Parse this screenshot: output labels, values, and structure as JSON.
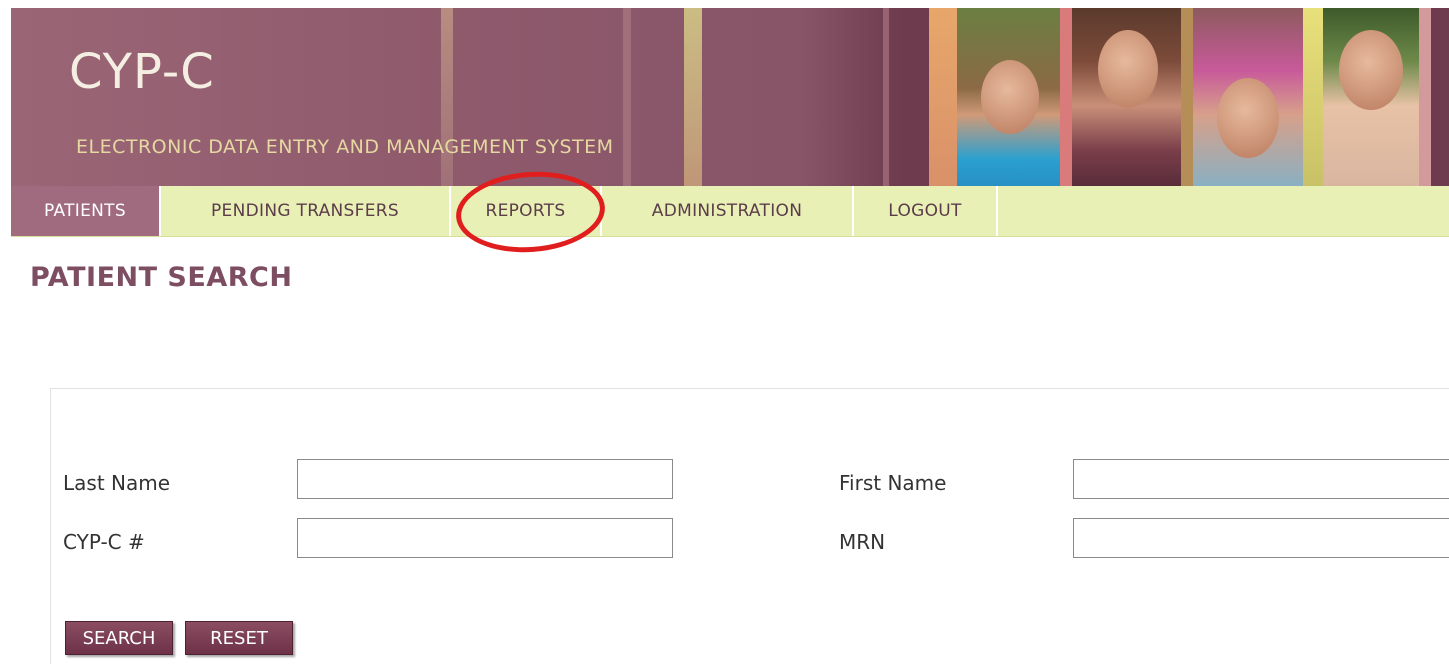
{
  "header": {
    "title": "CYP-C",
    "subtitle": "ELECTRONIC DATA ENTRY AND MANAGEMENT SYSTEM"
  },
  "nav": {
    "items": [
      {
        "label": "PATIENTS",
        "active": true
      },
      {
        "label": "PENDING TRANSFERS",
        "active": false
      },
      {
        "label": "REPORTS",
        "active": false
      },
      {
        "label": "ADMINISTRATION",
        "active": false
      },
      {
        "label": "LOGOUT",
        "active": false
      }
    ]
  },
  "page": {
    "title": "PATIENT SEARCH"
  },
  "form": {
    "last_name_label": "Last Name",
    "last_name_value": "",
    "first_name_label": "First Name",
    "first_name_value": "",
    "cypc_label": "CYP-C #",
    "cypc_value": "",
    "mrn_label": "MRN",
    "mrn_value": "",
    "search_label": "SEARCH",
    "reset_label": "RESET"
  },
  "colors": {
    "banner": "#8f5a6c",
    "nav_bg": "#e9f0b5",
    "nav_active": "#a06b7e",
    "title": "#7d4e62",
    "button": "#7a3d53",
    "annotation": "#e01e1e"
  }
}
